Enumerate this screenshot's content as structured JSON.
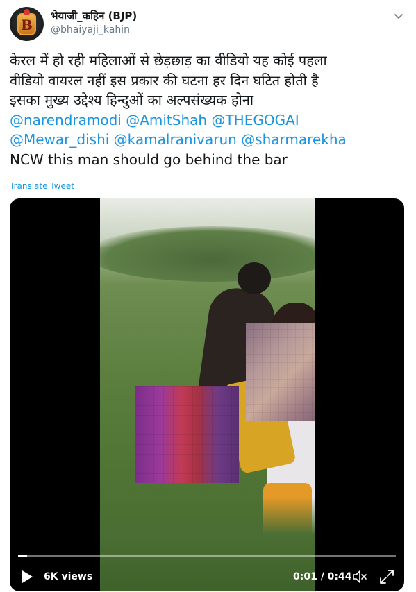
{
  "header": {
    "display_name": "भेयाजी_कहिन (BJP)",
    "handle": "@bhaiyaji_kahin",
    "avatar_icon": "B-logo-avatar",
    "menu_icon": "chevron-down-icon"
  },
  "tweet": {
    "lines": [
      "केरल में हो रही महिलाओं से छेड़छाड़ का वीडियो यह कोई पहला",
      "वीडियो वायरल नहीं इस प्रकार की घटना हर दिन घटित होती है",
      "इसका मुख्य उद्देश्य हिन्दुओं का अल्पसंख्यक होना"
    ],
    "mentions_line1": [
      "@narendramodi",
      "@AmitShah",
      "@THEGOGAI"
    ],
    "mentions_line2": [
      "@Mewar_dishi",
      "@kamalranivarun",
      "@sharmarekha"
    ],
    "last_line": "NCW this man should go behind the bar",
    "translate_label": "Translate Tweet",
    "mention_color": "#1b95e0"
  },
  "video": {
    "views": "6K views",
    "time": "0:01 / 0:44",
    "progress": 0.023,
    "play_icon": "play-icon",
    "mute_icon": "mute-icon",
    "expand_icon": "expand-icon"
  }
}
